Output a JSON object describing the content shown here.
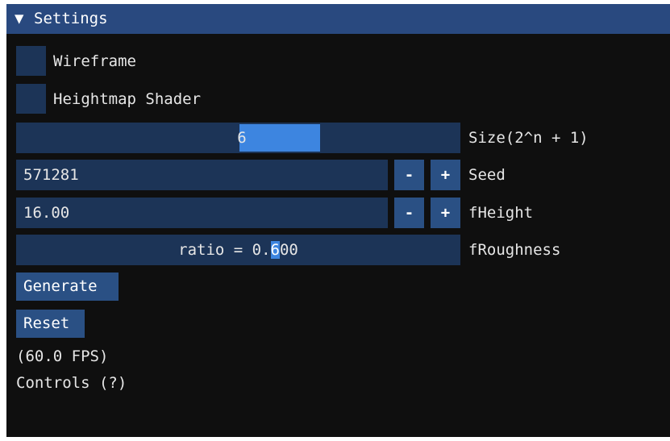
{
  "window": {
    "title": "Settings",
    "collapse_icon": "triangle-down-icon",
    "title_arrow": "▼"
  },
  "checkboxes": [
    {
      "label": "Wireframe",
      "checked": false
    },
    {
      "label": "Heightmap Shader",
      "checked": false
    }
  ],
  "size_slider": {
    "value": "6",
    "label": "Size(2^n + 1)"
  },
  "seed": {
    "value": "571281",
    "minus": "-",
    "plus": "+",
    "label": "Seed"
  },
  "fheight": {
    "value": "16.00",
    "minus": "-",
    "plus": "+",
    "label": "fHeight"
  },
  "roughness": {
    "text_before": "ratio = 0.",
    "text_highlight": "6",
    "text_after": "00",
    "label": "fRoughness"
  },
  "buttons": {
    "generate": "Generate",
    "reset": "Reset"
  },
  "status": {
    "fps": "(60.0 FPS)",
    "controls": "Controls (?)"
  },
  "colors": {
    "title_bar": "#29497f",
    "frame_bg": "#1c3457",
    "button": "#2a5084",
    "accent": "#3d85e0",
    "window_bg": "#0f0f0f"
  }
}
